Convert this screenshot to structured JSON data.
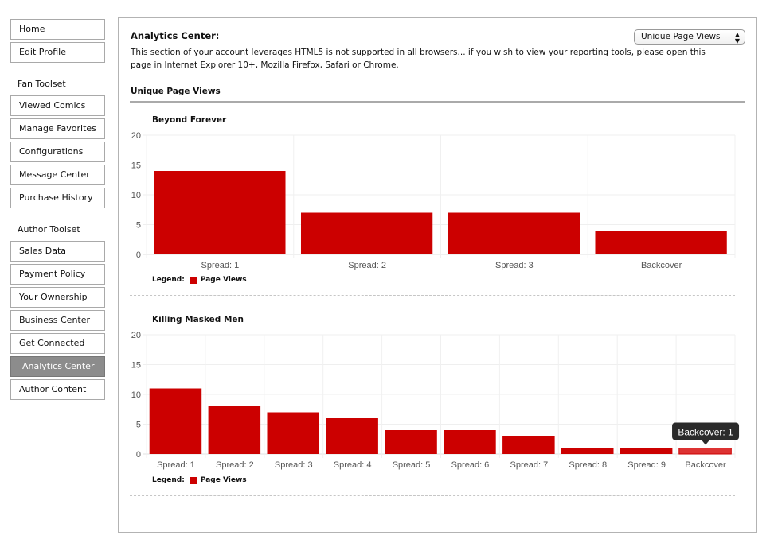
{
  "sidebar": {
    "top_items": [
      {
        "label": "Home"
      },
      {
        "label": "Edit Profile"
      }
    ],
    "fan_heading": "Fan Toolset",
    "fan_items": [
      {
        "label": "Viewed Comics"
      },
      {
        "label": "Manage Favorites"
      },
      {
        "label": "Configurations"
      },
      {
        "label": "Message Center"
      },
      {
        "label": "Purchase History"
      }
    ],
    "author_heading": "Author Toolset",
    "author_items": [
      {
        "label": "Sales Data"
      },
      {
        "label": "Payment Policy"
      },
      {
        "label": "Your Ownership"
      },
      {
        "label": "Business Center"
      },
      {
        "label": "Get Connected"
      },
      {
        "label": "Analytics Center",
        "active": true
      },
      {
        "label": "Author Content"
      }
    ]
  },
  "main": {
    "title": "Analytics Center:",
    "description": "This section of your account leverages HTML5 is not supported in all browsers... if you wish to view your reporting tools, please open this page in Internet Explorer 10+, Mozilla Firefox, Safari or Chrome.",
    "report_select": {
      "selected": "Unique Page Views",
      "icon": "updown-arrows-icon"
    },
    "section_title": "Unique Page Views",
    "legend_label": "Legend:"
  },
  "colors": {
    "bar": "#cc0000",
    "bar_highlight": "#dd3333",
    "tooltip_bg": "#2b2b2b",
    "active_nav": "#8c8c8c"
  },
  "chart_data": [
    {
      "type": "bar",
      "title": "Beyond Forever",
      "categories": [
        "Spread: 1",
        "Spread: 2",
        "Spread: 3",
        "Backcover"
      ],
      "series": [
        {
          "name": "Page Views",
          "values": [
            14,
            7,
            7,
            4
          ]
        }
      ],
      "yticks": [
        0,
        5,
        10,
        15,
        20
      ],
      "ylim": [
        0,
        20
      ],
      "xlabel": "",
      "ylabel": "",
      "grid": true,
      "legend": "bottom-left"
    },
    {
      "type": "bar",
      "title": "Killing Masked Men",
      "categories": [
        "Spread: 1",
        "Spread: 2",
        "Spread: 3",
        "Spread: 4",
        "Spread: 5",
        "Spread: 6",
        "Spread: 7",
        "Spread: 8",
        "Spread: 9",
        "Backcover"
      ],
      "series": [
        {
          "name": "Page Views",
          "values": [
            11,
            8,
            7,
            6,
            4,
            4,
            3,
            1,
            1,
            1
          ]
        }
      ],
      "yticks": [
        0,
        5,
        10,
        15,
        20
      ],
      "ylim": [
        0,
        20
      ],
      "xlabel": "",
      "ylabel": "",
      "grid": true,
      "legend": "bottom-left",
      "highlighted_index": 9,
      "tooltip": "Backcover: 1"
    }
  ]
}
